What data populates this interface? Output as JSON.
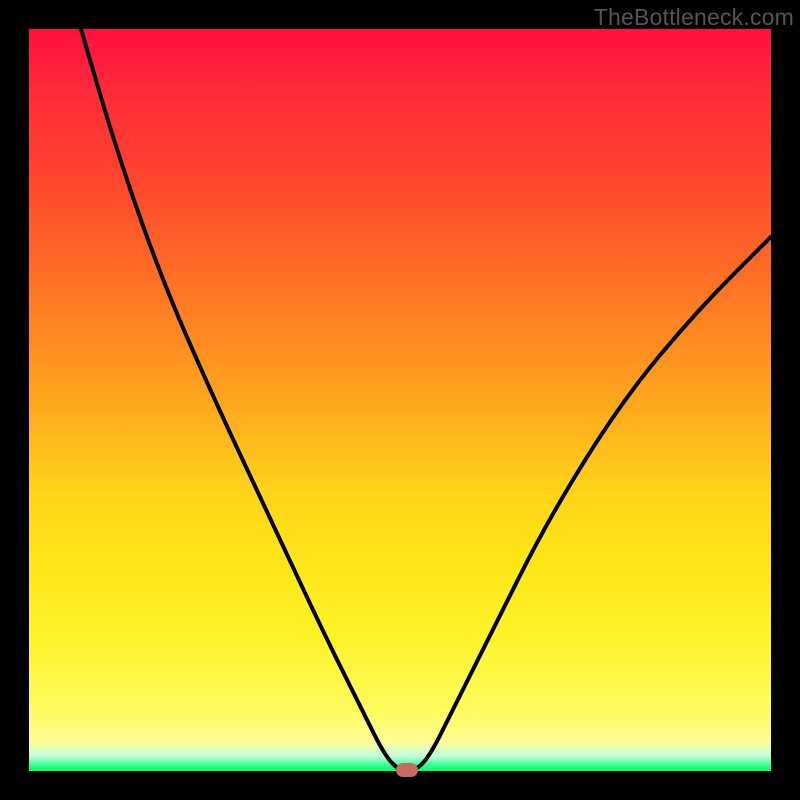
{
  "watermark": "TheBottleneck.com",
  "chart_data": {
    "type": "line",
    "title": "",
    "xlabel": "",
    "ylabel": "",
    "xlim": [
      0,
      100
    ],
    "ylim": [
      0,
      100
    ],
    "grid": false,
    "legend": false,
    "series": [
      {
        "name": "curve",
        "x": [
          7,
          12,
          18,
          25,
          33,
          40,
          45,
          48,
          50,
          52,
          54,
          57,
          62,
          70,
          80,
          90,
          100
        ],
        "values": [
          100,
          83,
          66,
          50,
          33,
          18,
          8,
          2,
          0,
          0,
          2,
          8,
          18,
          34,
          50,
          62,
          72
        ]
      }
    ],
    "marker": {
      "x": 51,
      "y": 0.2,
      "shape": "pill",
      "color": "#c96a60"
    },
    "background_gradient": {
      "type": "vertical",
      "stops": [
        {
          "pos": 0,
          "color": "#ff1040"
        },
        {
          "pos": 50,
          "color": "#ffa61e"
        },
        {
          "pos": 82,
          "color": "#fff22a"
        },
        {
          "pos": 99,
          "color": "#1eff80"
        },
        {
          "pos": 100,
          "color": "#00ff66"
        }
      ]
    }
  }
}
